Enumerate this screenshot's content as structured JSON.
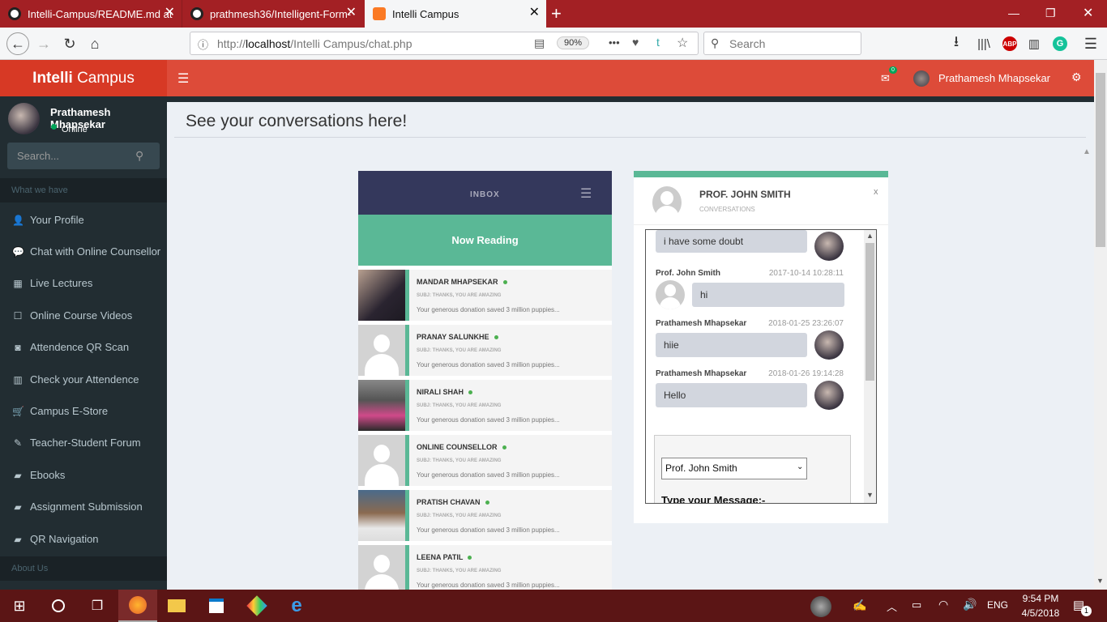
{
  "browser": {
    "tabs": [
      {
        "title": "Intelli-Campus/README.md at"
      },
      {
        "title": "prathmesh36/Intelligent-Form-"
      },
      {
        "title": "Intelli Campus"
      }
    ],
    "new_tab": "+",
    "url_prefix": "http://",
    "url_host": "localhost",
    "url_path": "/Intelli Campus/chat.php",
    "zoom": "90%",
    "menu_dots": "•••",
    "search_placeholder": "Search",
    "abp": "ABP"
  },
  "app": {
    "brand_bold": "Intelli",
    "brand_rest": "Campus",
    "mail_count": "0",
    "user_name": "Prathamesh Mhapsekar",
    "sidebar": {
      "user_name": "Prathamesh Mhapsekar",
      "status": "Online",
      "search_placeholder": "Search...",
      "section1": "What we have",
      "items": [
        {
          "label": "Your Profile",
          "icon": "user-icon"
        },
        {
          "label": "Chat with Online Counsellor",
          "icon": "comment-icon"
        },
        {
          "label": "Live Lectures",
          "icon": "calendar-icon"
        },
        {
          "label": "Online Course Videos",
          "icon": "square-icon"
        },
        {
          "label": "Attendence QR Scan",
          "icon": "camera-icon"
        },
        {
          "label": "Check your Attendence",
          "icon": "bar-chart-icon"
        },
        {
          "label": "Campus E-Store",
          "icon": "cart-icon"
        },
        {
          "label": "Teacher-Student Forum",
          "icon": "edit-icon"
        },
        {
          "label": "Ebooks",
          "icon": "book-icon"
        },
        {
          "label": "Assignment Submission",
          "icon": "book-icon"
        },
        {
          "label": "QR Navigation",
          "icon": "book-icon"
        }
      ],
      "section2": "About Us"
    },
    "page_title": "See your conversations here!",
    "inbox": {
      "header": "INBOX",
      "now_reading": "Now Reading",
      "messages": [
        {
          "name": "MANDAR MHAPSEKAR",
          "subject": "SUBJ: THANKS, YOU ARE AMAZING",
          "preview": "Your generous donation saved 3 million puppies..."
        },
        {
          "name": "PRANAY SALUNKHE",
          "subject": "SUBJ: THANKS, YOU ARE AMAZING",
          "preview": "Your generous donation saved 3 million puppies..."
        },
        {
          "name": "NIRALI SHAH",
          "subject": "SUBJ: THANKS, YOU ARE AMAZING",
          "preview": "Your generous donation saved 3 million puppies..."
        },
        {
          "name": "ONLINE COUNSELLOR",
          "subject": "SUBJ: THANKS, YOU ARE AMAZING",
          "preview": "Your generous donation saved 3 million puppies..."
        },
        {
          "name": "PRATISH CHAVAN",
          "subject": "SUBJ: THANKS, YOU ARE AMAZING",
          "preview": "Your generous donation saved 3 million puppies..."
        },
        {
          "name": "LEENA PATIL",
          "subject": "SUBJ: THANKS, YOU ARE AMAZING",
          "preview": "Your generous donation saved 3 million puppies..."
        }
      ]
    },
    "chat": {
      "contact": "PROF. JOHN SMITH",
      "subtitle": "CONVERSATIONS",
      "close": "x",
      "messages": [
        {
          "text": "i have some doubt"
        },
        {
          "sender": "Prof. John Smith",
          "time": "2017-10-14 10:28:11",
          "text": "hi"
        },
        {
          "sender": "Prathamesh Mhapsekar",
          "time": "2018-01-25 23:26:07",
          "text": "hiie"
        },
        {
          "sender": "Prathamesh Mhapsekar",
          "time": "2018-01-26 19:14:28",
          "text": "Hello"
        }
      ],
      "recipient_select": "Prof. John Smith",
      "type_label": "Type your Message:-"
    }
  },
  "taskbar": {
    "time": "9:54 PM",
    "date": "4/5/2018",
    "lang": "ENG",
    "notif_count": "1"
  },
  "colors": {
    "tab_bar": "#a32024",
    "header": "#dd4b39",
    "brand": "#d73925",
    "sidebar": "#222d32",
    "inbox_header": "#34385c",
    "accent_green": "#5ab896"
  }
}
